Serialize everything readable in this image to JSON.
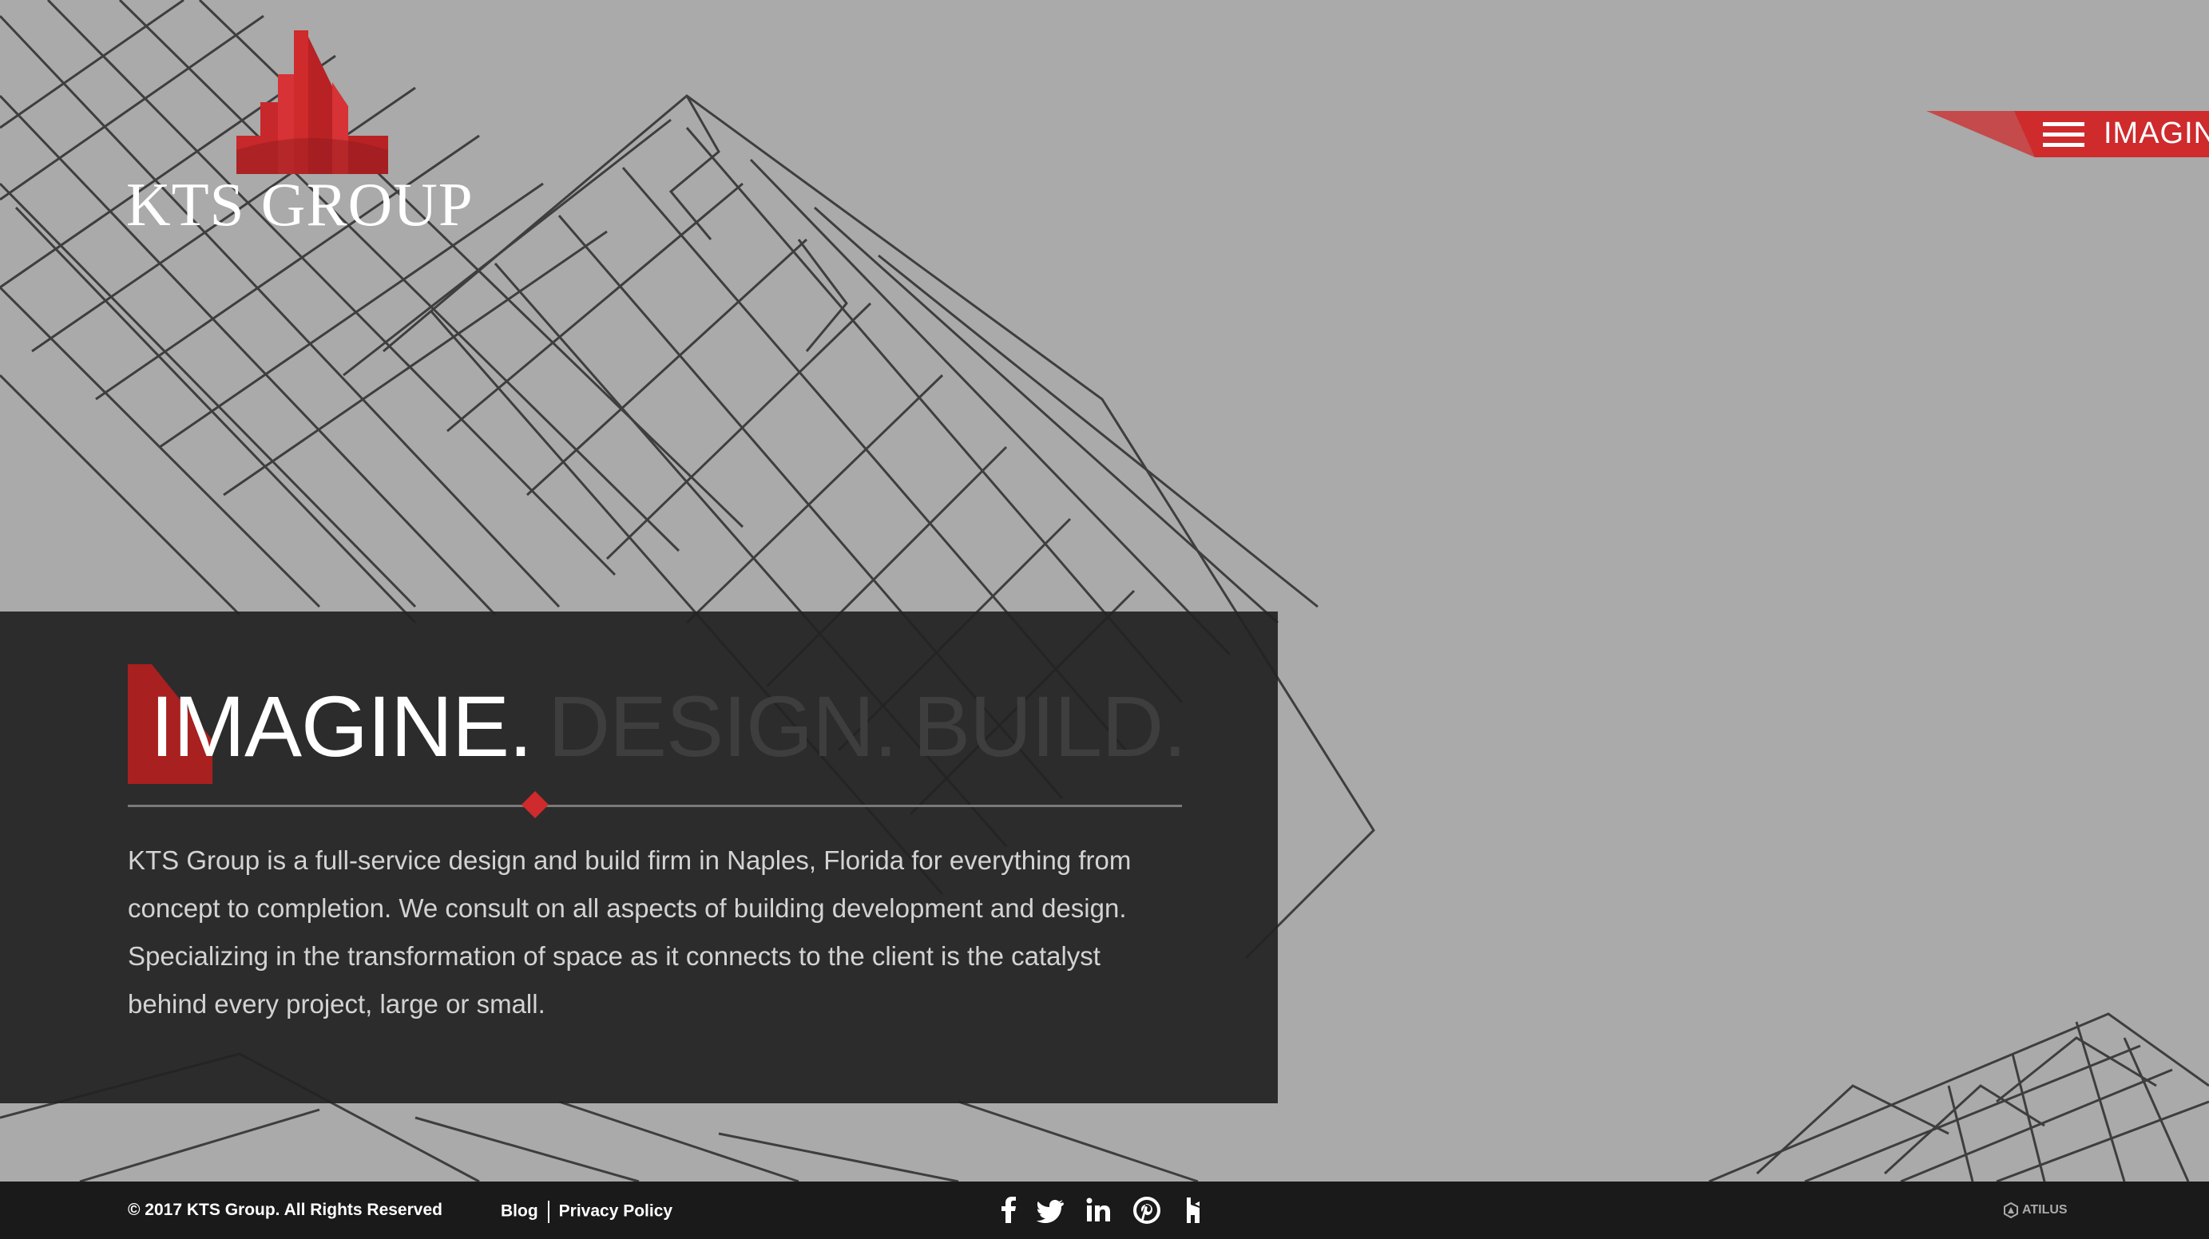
{
  "brand": {
    "logo_text": "KTS GROUP",
    "accent_color": "#cf2a2c"
  },
  "menu": {
    "label": "IMAGINE",
    "icon": "hamburger-menu-icon"
  },
  "hero": {
    "headline_word_1": "IMAGINE.",
    "headline_word_2": "DESIGN.",
    "headline_word_3": "BUILD.",
    "description": "KTS Group is a full-service design and build firm in Naples, Florida for everything from concept to completion. We consult on all aspects of building development and design. Specializing in the transformation of space as it connects to the client is the catalyst behind every project, large or small."
  },
  "footer": {
    "copyright": "© 2017 KTS Group. All Rights Reserved",
    "links": [
      {
        "label": "Blog"
      },
      {
        "label": "Privacy Policy"
      }
    ],
    "social": [
      {
        "name": "facebook-icon"
      },
      {
        "name": "twitter-icon"
      },
      {
        "name": "linkedin-icon"
      },
      {
        "name": "pinterest-icon"
      },
      {
        "name": "houzz-icon"
      }
    ],
    "credit": "ATILUS"
  }
}
